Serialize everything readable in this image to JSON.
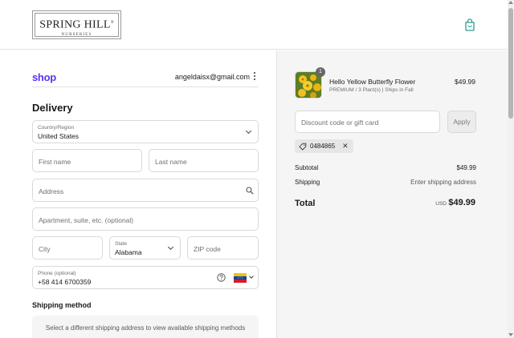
{
  "header": {
    "logo_main": "SPRING HILL",
    "logo_registered": "®",
    "logo_sub": "NURSERIES",
    "bag_icon": "shopping-bag-icon",
    "accent": "#2a9d8f"
  },
  "account": {
    "shop_label": "shop",
    "shop_color": "#5a31f4",
    "email": "angeldaisx@gmail.com"
  },
  "delivery": {
    "heading": "Delivery",
    "country": {
      "label": "Country/Region",
      "value": "United States"
    },
    "first_name_placeholder": "First name",
    "last_name_placeholder": "Last name",
    "address_placeholder": "Address",
    "apartment_placeholder": "Apartment, suite, etc. (optional)",
    "city_placeholder": "City",
    "state": {
      "label": "State",
      "value": "Alabama"
    },
    "zip_placeholder": "ZIP code",
    "phone": {
      "label": "Phone (optional)",
      "value": "+58 414 6700359",
      "flag": "venezuela-flag"
    }
  },
  "shipping": {
    "heading": "Shipping method",
    "message": "Select a different shipping address to view available shipping methods"
  },
  "summary": {
    "item": {
      "quantity": "1",
      "name": "Hello Yellow Butterfly Flower",
      "meta": "PREMIUM / 3 Plant(s) | Ships in Fall",
      "price": "$49.99"
    },
    "discount_placeholder": "Discount code or gift card",
    "apply_label": "Apply",
    "applied_code": "0484865",
    "subtotal_label": "Subtotal",
    "subtotal_value": "$49.99",
    "shipping_label": "Shipping",
    "shipping_value": "Enter shipping address",
    "total_label": "Total",
    "total_currency": "USD",
    "total_value": "$49.99"
  }
}
